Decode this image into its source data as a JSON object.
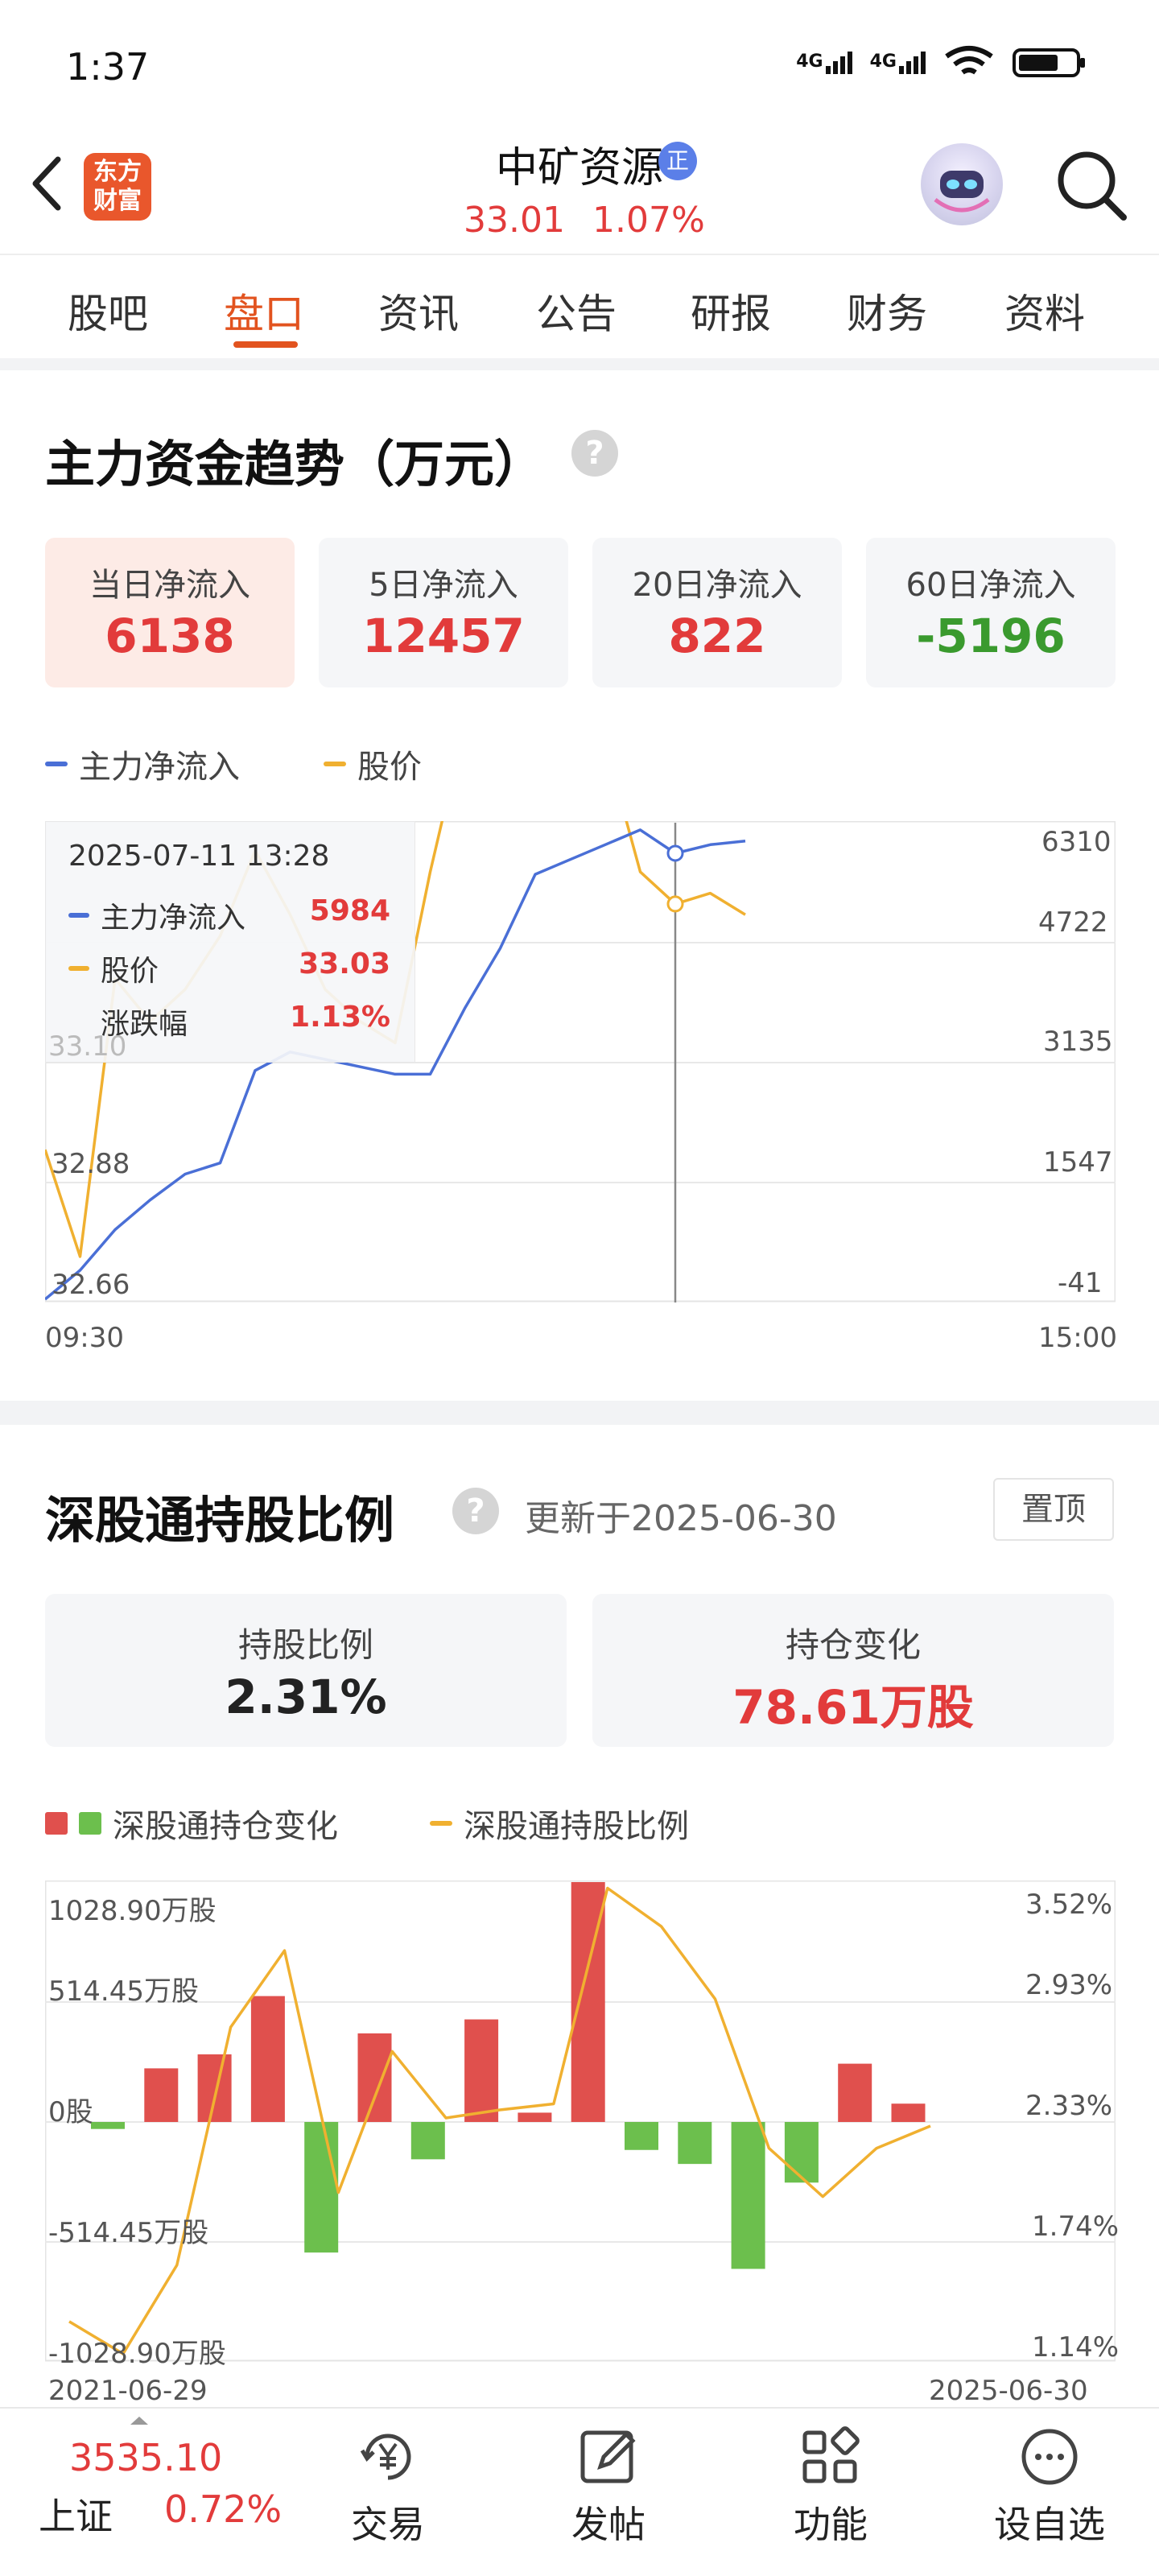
{
  "status": {
    "time": "1:37",
    "net1": "4G",
    "net2": "4G",
    "wifi_sub": "6"
  },
  "header": {
    "stock_name": "中矿资源",
    "badge": "正",
    "price": "33.01",
    "change": "1.07%",
    "logo_line1": "东方",
    "logo_line2": "财富"
  },
  "tabs": [
    "股吧",
    "盘口",
    "资讯",
    "公告",
    "研报",
    "财务",
    "资料"
  ],
  "active_tab": "盘口",
  "capital": {
    "title": "主力资金趋势（万元）",
    "help": "?",
    "boxes": [
      {
        "label": "当日净流入",
        "value": "6138"
      },
      {
        "label": "5日净流入",
        "value": "12457"
      },
      {
        "label": "20日净流入",
        "value": "822"
      },
      {
        "label": "60日净流入",
        "value": "-5196"
      }
    ],
    "legend": {
      "series1": "主力净流入",
      "series2": "股价",
      "color1": "#4a6fd6",
      "color2": "#f0b030"
    },
    "tooltip": {
      "date": "2025-07-11 13:28",
      "row1_label": "主力净流入",
      "row1_value": "5984",
      "row2_label": "股价",
      "row2_value": "33.03",
      "row3_label": "涨跌幅",
      "row3_value": "1.13%"
    },
    "axis": {
      "left_ticks": [
        "33.10",
        "32.88",
        "32.66"
      ],
      "right_ticks": [
        "6310",
        "4722",
        "3135",
        "1547",
        "-41"
      ],
      "x_start": "09:30",
      "x_end": "15:00"
    }
  },
  "chart_data": [
    {
      "type": "line",
      "title": "主力资金趋势（万元）",
      "x_range": [
        "09:30",
        "15:00"
      ],
      "series": [
        {
          "name": "主力净流入",
          "color": "#4a6fd6",
          "x": [
            "09:30",
            "09:40",
            "09:50",
            "10:00",
            "10:10",
            "10:20",
            "10:30",
            "10:40",
            "10:50",
            "11:00",
            "11:10",
            "11:20",
            "11:30",
            "13:00",
            "13:10",
            "13:20",
            "13:30",
            "13:40",
            "13:50",
            "14:00",
            "14:05"
          ],
          "values": [
            -41,
            350,
            900,
            1300,
            1650,
            1800,
            3050,
            3300,
            3200,
            3100,
            3000,
            3000,
            3900,
            4700,
            5700,
            5900,
            6100,
            6300,
            5984,
            6100,
            6150
          ]
        },
        {
          "name": "股价",
          "color": "#f0b030",
          "x": [
            "09:30",
            "09:40",
            "09:50",
            "10:00",
            "10:10",
            "10:20",
            "10:30",
            "10:40",
            "10:50",
            "11:00",
            "11:10",
            "11:20",
            "11:30",
            "13:00",
            "13:10",
            "13:20",
            "13:30",
            "13:40",
            "13:50",
            "14:00",
            "14:05"
          ],
          "values": [
            32.8,
            32.7,
            32.96,
            32.92,
            32.95,
            33.0,
            33.08,
            33.02,
            32.95,
            32.92,
            32.9,
            33.06,
            33.2,
            33.3,
            33.28,
            33.22,
            33.18,
            33.06,
            33.03,
            33.04,
            33.02
          ]
        }
      ],
      "right_axis_range": [
        -41,
        6310
      ],
      "left_axis_range": [
        32.66,
        33.1
      ]
    },
    {
      "type": "bar",
      "title": "深股通持股比例",
      "x_range": [
        "2021-06-29",
        "2025-06-30"
      ],
      "series": [
        {
          "name": "深股通持仓变化",
          "unit": "万股",
          "values": [
            -30,
            230,
            290,
            540,
            -560,
            380,
            -160,
            440,
            40,
            1028.9,
            -120,
            -180,
            -630,
            -260,
            250,
            78.61
          ]
        },
        {
          "name": "深股通持股比例",
          "unit": "%",
          "values": [
            1.34,
            1.18,
            1.62,
            2.8,
            3.18,
            1.98,
            2.68,
            2.35,
            2.39,
            2.42,
            3.49,
            3.3,
            2.94,
            2.2,
            1.96,
            2.2,
            2.31
          ]
        }
      ],
      "left_axis_range": [
        -1028.9,
        1028.9
      ],
      "right_axis_range": [
        1.14,
        3.52
      ]
    }
  ],
  "hk": {
    "title": "深股通持股比例",
    "help": "?",
    "update": "更新于2025-06-30",
    "pin": "置顶",
    "ratio_label": "持股比例",
    "ratio_value": "2.31%",
    "change_label": "持仓变化",
    "change_value": "78.61万股",
    "legend_bar": "深股通持仓变化",
    "legend_line": "深股通持股比例",
    "left_ticks": [
      "1028.90万股",
      "514.45万股",
      "0股",
      "-514.45万股",
      "-1028.90万股"
    ],
    "right_ticks": [
      "3.52%",
      "2.93%",
      "2.33%",
      "1.74%",
      "1.14%"
    ],
    "x_start": "2021-06-29",
    "x_end": "2025-06-30",
    "colors": {
      "up": "#e0504d",
      "down": "#6cbf4d",
      "line": "#f0b030"
    }
  },
  "bottom": {
    "index_value": "3535.10",
    "index_name": "上证",
    "index_change": "0.72%",
    "nav": [
      "交易",
      "发帖",
      "功能",
      "设自选"
    ]
  }
}
